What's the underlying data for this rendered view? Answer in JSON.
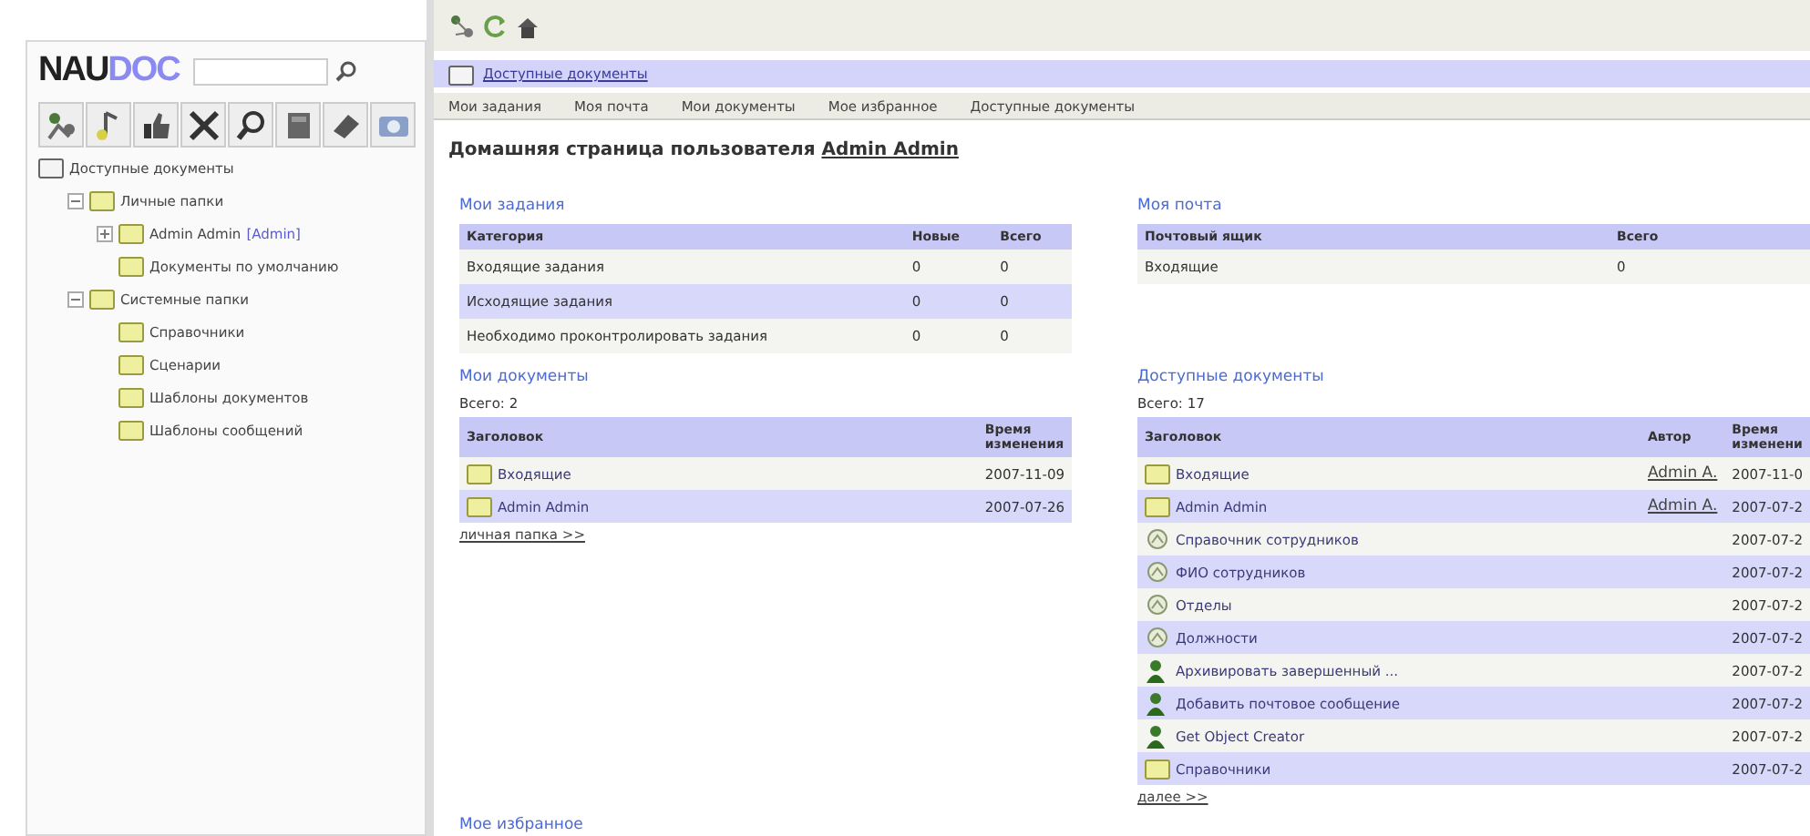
{
  "sidebar": {
    "logo": {
      "part_1": "NAU",
      "part_2": "DOC"
    },
    "tree": [
      {
        "label": "Доступные документы",
        "children": [
          {
            "label": "Личные папки",
            "expanded": true,
            "children": [
              {
                "label": "Admin Admin",
                "tag": "[Admin]",
                "expanded": false
              },
              {
                "label": "Документы по умолчанию"
              }
            ]
          },
          {
            "label": "Системные папки",
            "expanded": true,
            "children": [
              {
                "label": "Справочники"
              },
              {
                "label": "Сценарии"
              },
              {
                "label": "Шаблоны документов"
              },
              {
                "label": "Шаблоны сообщений"
              }
            ]
          }
        ]
      }
    ]
  },
  "breadcrumb": "Доступные документы",
  "tabs": [
    "Мои задания",
    "Моя почта",
    "Мои документы",
    "Мое избранное",
    "Доступные документы"
  ],
  "heading": {
    "text": "Домашняя страница пользователя",
    "user": "Admin Admin"
  },
  "tasks": {
    "title": "Мои задания",
    "columns": [
      "Категория",
      "Новые",
      "Всего"
    ],
    "rows": [
      [
        "Входящие задания",
        "0",
        "0"
      ],
      [
        "Исходящие задания",
        "0",
        "0"
      ],
      [
        "Необходимо проконтролировать задания",
        "0",
        "0"
      ]
    ]
  },
  "mail": {
    "title": "Моя почта",
    "columns": [
      "Почтовый ящик",
      "Всего"
    ],
    "rows": [
      [
        "Входящие",
        "0"
      ]
    ]
  },
  "my_documents": {
    "title": "Мои документы",
    "count": "Всего: 2",
    "columns": [
      "Заголовок",
      "Время изменения"
    ],
    "rows": [
      {
        "kind": "folder",
        "title": "Входящие",
        "time": "2007-11-09"
      },
      {
        "kind": "folder",
        "title": "Admin Admin",
        "time": "2007-07-26"
      }
    ],
    "more": "личная папка >>"
  },
  "available_documents": {
    "title": "Доступные документы",
    "count": "Всего: 17",
    "columns": [
      "Заголовок",
      "Автор",
      "Время изменени"
    ],
    "rows": [
      {
        "kind": "folder",
        "title": "Входящие",
        "author": "Admin A.",
        "time": "2007-11-0"
      },
      {
        "kind": "folder",
        "title": "Admin Admin",
        "author": "Admin A.",
        "time": "2007-07-2"
      },
      {
        "kind": "directory",
        "title": "Справочник сотрудников",
        "time": "2007-07-2"
      },
      {
        "kind": "directory",
        "title": "ФИО сотрудников",
        "time": "2007-07-2"
      },
      {
        "kind": "directory",
        "title": "Отделы",
        "time": "2007-07-2"
      },
      {
        "kind": "directory",
        "title": "Должности",
        "time": "2007-07-2"
      },
      {
        "kind": "script",
        "title": "Архивировать завершенный ...",
        "time": "2007-07-2"
      },
      {
        "kind": "script",
        "title": "Добавить почтовое сообщение",
        "time": "2007-07-2"
      },
      {
        "kind": "script",
        "title": "Get Object Creator",
        "time": "2007-07-2"
      },
      {
        "kind": "folder",
        "title": "Справочники",
        "time": "2007-07-2"
      }
    ],
    "more": "далее >>"
  },
  "favorites": {
    "title": "Мое избранное"
  }
}
